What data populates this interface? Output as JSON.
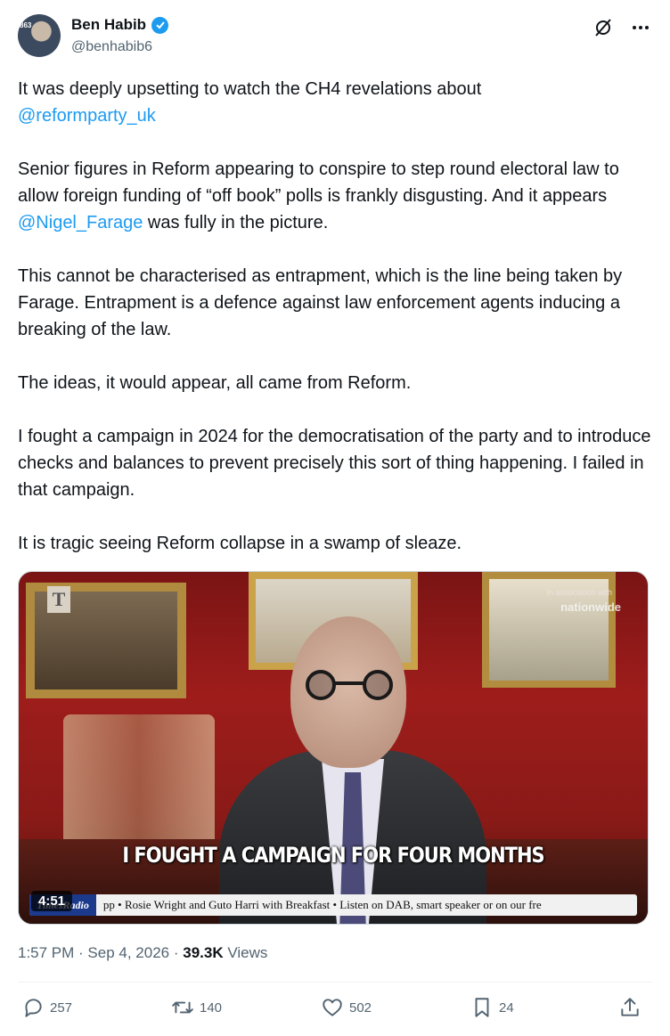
{
  "author": {
    "name": "Ben Habib",
    "handle": "@benhabib6",
    "avatar_badge": "863"
  },
  "header_icons": {
    "grok": "grok-slash-icon",
    "more": "more-dots-icon"
  },
  "tweet": {
    "p1_text": "It was deeply upsetting to watch the CH4 revelations about ",
    "p1_mention": "@reformparty_uk",
    "p2_text": "Senior figures in Reform appearing to conspire to step round electoral law to allow foreign funding of “off book” polls is frankly disgusting. And it appears ",
    "p2_mention": "@Nigel_Farage",
    "p2_tail": " was fully in the picture.",
    "p3": "This cannot be characterised as entrapment, which is the line being taken by Farage. Entrapment is a defence against law enforcement agents inducing a breaking of the law.",
    "p4": "The ideas, it would appear, all came from Reform.",
    "p5": "I fought a campaign in 2024 for the democratisation of the party and to introduce checks and balances to prevent precisely this sort of thing happening. I failed in that campaign.",
    "p6": "It is tragic seeing Reform collapse in a swamp of sleaze."
  },
  "video": {
    "logo": "T",
    "sponsor_small": "In association with",
    "sponsor": "nationwide",
    "caption": "I FOUGHT A CAMPAIGN FOR FOUR MONTHS",
    "duration": "4:51",
    "ticker_brand": "TimesRadio",
    "ticker_items": "pp   •   Rosie Wright and Guto Harri with Breakfast   •   Listen on DAB, smart speaker or on our fre"
  },
  "meta": {
    "time": "1:57 PM",
    "sep1": " · ",
    "date": "Sep 4, 2026",
    "sep2": " · ",
    "views_count": "39.3K",
    "views_label": " Views"
  },
  "actions": {
    "replies": "257",
    "reposts": "140",
    "likes": "502",
    "bookmarks": "24"
  },
  "colors": {
    "accent": "#1d9bf0",
    "text": "#0f1419",
    "secondary": "#536471"
  }
}
